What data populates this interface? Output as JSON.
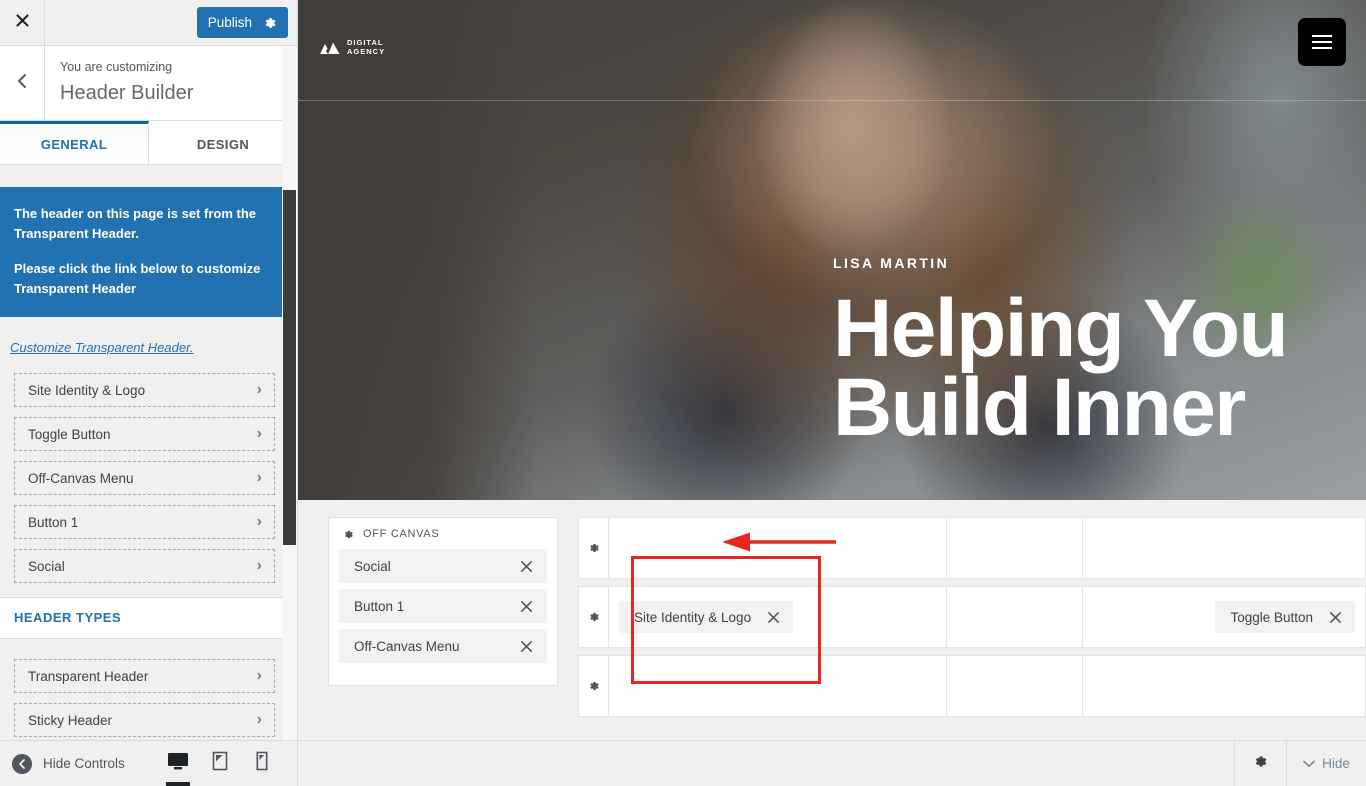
{
  "sidebar": {
    "topbar": {
      "close_icon": "close-icon",
      "publish_label": "Publish",
      "publish_gear_icon": "gear-icon"
    },
    "header": {
      "back_icon": "chevron-left-icon",
      "eyebrow": "You are customizing",
      "title": "Header Builder"
    },
    "tabs": [
      {
        "label": "GENERAL",
        "active": true
      },
      {
        "label": "DESIGN",
        "active": false
      }
    ],
    "notice": {
      "line1": "The header on this page is set from the Transparent Header.",
      "line2": "Please click the link below to customize Transparent Header"
    },
    "customize_link": "Customize Transparent Header.",
    "items": [
      {
        "label": "Site Identity & Logo"
      },
      {
        "label": "Toggle Button"
      },
      {
        "label": "Off-Canvas Menu"
      },
      {
        "label": "Button 1"
      },
      {
        "label": "Social"
      }
    ],
    "header_types": {
      "title": "HEADER TYPES",
      "items": [
        {
          "label": "Transparent Header"
        },
        {
          "label": "Sticky Header"
        }
      ]
    },
    "footer": {
      "hide_controls_label": "Hide Controls",
      "devices": [
        {
          "name": "desktop",
          "active": true
        },
        {
          "name": "tablet",
          "active": false
        },
        {
          "name": "mobile",
          "active": false
        }
      ]
    }
  },
  "preview": {
    "hero": {
      "logo_text_line1": "DIGITAL",
      "logo_text_line2": "AGENCY",
      "toggle_icon": "hamburger-icon",
      "eyebrow": "LISA MARTIN",
      "headline_line1": "Helping You",
      "headline_line2": "Build Inner"
    },
    "offcanvas": {
      "title": "OFF CANVAS",
      "gear_icon": "gear-icon",
      "items": [
        {
          "label": "Social"
        },
        {
          "label": "Button 1"
        },
        {
          "label": "Off-Canvas Menu"
        }
      ]
    },
    "builder_rows": [
      {
        "cells": [
          {
            "chip": null
          },
          {
            "chip": null
          },
          {
            "chip": null
          }
        ]
      },
      {
        "cells": [
          {
            "chip": "Site Identity & Logo"
          },
          {
            "chip": null
          },
          {
            "chip": "Toggle Button"
          }
        ]
      },
      {
        "cells": [
          {
            "chip": null
          },
          {
            "chip": null
          },
          {
            "chip": null
          }
        ]
      }
    ],
    "footer": {
      "gear_icon": "gear-icon",
      "hide_label": "Hide",
      "hide_chevron_icon": "chevron-down-icon"
    }
  },
  "annotation": {
    "box_color": "#e8281e",
    "arrow_color": "#e8281e"
  }
}
